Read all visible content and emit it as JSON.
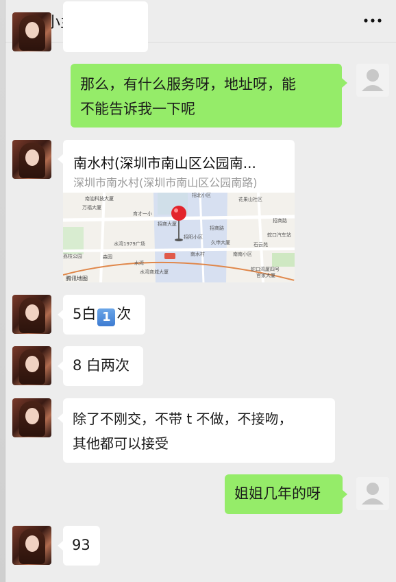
{
  "header": {
    "title": "小兰",
    "back_icon": "chevron-left-icon",
    "more_icon": "more-dots-icon"
  },
  "messages": [
    {
      "from": "me",
      "text_line1": "那么，有什么服务呀，地址呀，能",
      "text_line2": "不能告诉我一下呢"
    },
    {
      "from": "her",
      "type": "location",
      "title": "南水村(深圳市南山区公园南...",
      "subtitle": "深圳市南水村(深圳市南山区公园南路)",
      "map_labels": {
        "wanfu": "万福大厦",
        "nanyou_tech": "南油科技大厦",
        "zhaobei": "招北小区",
        "huaguo": "花果山社区",
        "yucai": "育才一小",
        "zhaoshang": "招商大厦",
        "zhaoshang_road": "招商路",
        "zhaoshang2": "招商路",
        "yuwan": "水湾1979广场",
        "zhaoyang": "招阳小区",
        "jiushen": "久申大厦",
        "shekou_bus": "蛇口汽车站",
        "shiyun": "石云苑",
        "shekou_park": "荔枝公园",
        "senlin": "森园",
        "nanshui": "南水村",
        "nanshan_small": "南南小区",
        "shuiwan": "水湾",
        "shuiwan_station": "水湾商城大厦",
        "shekou_bay": "蛇口湾厦四号",
        "gongyu": "官家大厦",
        "map_brand": "腾讯地图"
      }
    },
    {
      "from": "her",
      "text_prefix": "5白",
      "badge": "1",
      "text_suffix": "次"
    },
    {
      "from": "her",
      "text": "8 白两次"
    },
    {
      "from": "her",
      "text_line1": "除了不刚交，不带 t 不做，不接吻，",
      "text_line2": "其他都可以接受"
    },
    {
      "from": "me",
      "text": "姐姐几年的呀"
    },
    {
      "from": "her",
      "text": "93"
    }
  ],
  "colors": {
    "background": "#ededed",
    "green_bubble": "#95ec69",
    "white_bubble": "#ffffff",
    "subtitle_gray": "#9a9a9a"
  }
}
